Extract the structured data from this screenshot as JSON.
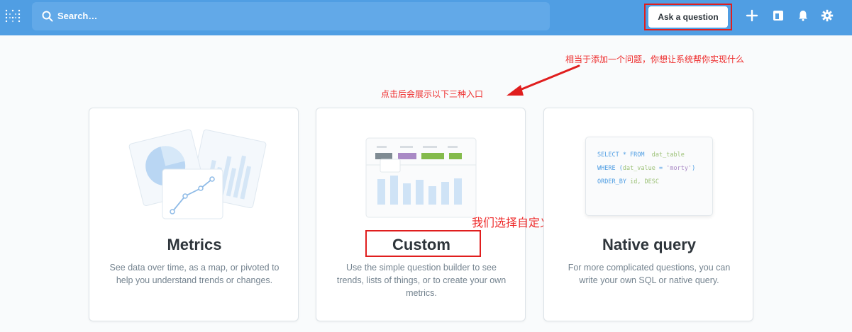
{
  "topbar": {
    "search_placeholder": "Search…",
    "ask_button_label": "Ask a question",
    "icons": [
      "plus-icon",
      "dashboard-icon",
      "bell-icon",
      "gear-icon"
    ]
  },
  "annotations": {
    "ask_note": "相当于添加一个问题，你想让系统帮你实现什么",
    "entries_note": "点击后会展示以下三种入口",
    "custom_note": "我们选择自定义"
  },
  "cards": [
    {
      "title": "Metrics",
      "description": "See data over time, as a map, or pivoted to help you understand trends or changes."
    },
    {
      "title": "Custom",
      "description": "Use the simple question builder to see trends, lists of things, or to create your own metrics."
    },
    {
      "title": "Native query",
      "description": "For more complicated questions, you can write your own SQL or native query."
    }
  ],
  "sql_sample": {
    "line1_kw": "SELECT * FROM",
    "line1_id": "dat_table",
    "line2_kw": "WHERE (",
    "line2_id": "dat_value",
    "line2_op": " = ",
    "line2_str": "'morty'",
    "line2_end": ")",
    "line3_kw": "ORDER_BY",
    "line3_id": "id, DESC"
  },
  "colors": {
    "brand": "#509ee3",
    "annotation": "#ee2d2d"
  }
}
